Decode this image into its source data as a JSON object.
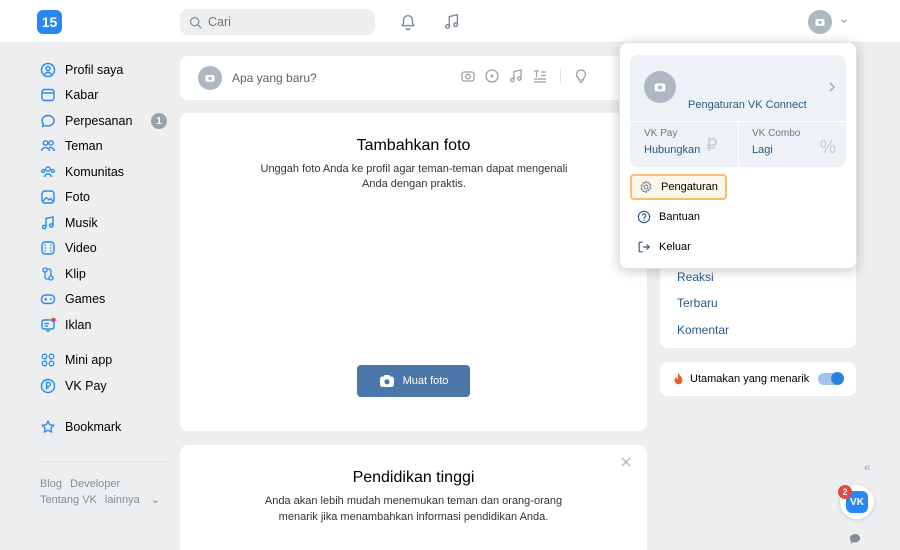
{
  "header": {
    "logo_text": "15",
    "search_placeholder": "Cari"
  },
  "sidebar": {
    "items": [
      {
        "label": "Profil saya",
        "icon": "user-circle-icon"
      },
      {
        "label": "Kabar",
        "icon": "newsfeed-icon"
      },
      {
        "label": "Perpesanan",
        "icon": "message-icon",
        "badge": "1"
      },
      {
        "label": "Teman",
        "icon": "friends-icon"
      },
      {
        "label": "Komunitas",
        "icon": "communities-icon"
      },
      {
        "label": "Foto",
        "icon": "photo-icon"
      },
      {
        "label": "Musik",
        "icon": "music-icon"
      },
      {
        "label": "Video",
        "icon": "video-icon"
      },
      {
        "label": "Klip",
        "icon": "clips-icon"
      },
      {
        "label": "Games",
        "icon": "games-icon"
      },
      {
        "label": "Iklan",
        "icon": "ads-icon"
      }
    ],
    "items2": [
      {
        "label": "Mini app",
        "icon": "mini-app-icon"
      },
      {
        "label": "VK Pay",
        "icon": "vk-pay-icon"
      }
    ],
    "bookmark": "Bookmark",
    "footer": {
      "blog": "Blog",
      "developer": "Developer",
      "about": "Tentang VK",
      "more": "lainnya"
    }
  },
  "composer": {
    "placeholder": "Apa yang baru?"
  },
  "photo_card": {
    "title": "Tambahkan foto",
    "description": "Unggah foto Anda ke profil agar teman-teman dapat mengenali Anda dengan praktis.",
    "button": "Muat foto"
  },
  "edu_card": {
    "title": "Pendidikan tinggi",
    "description": "Anda akan lebih mudah menemukan teman dan orang-orang menarik jika menambahkan informasi pendidikan Anda."
  },
  "filters": {
    "items": [
      "Reaksi",
      "Terbaru",
      "Komentar"
    ]
  },
  "highlight_toggle": {
    "label": "Utamakan yang menarik"
  },
  "dropdown": {
    "vk_connect": "Pengaturan VK Connect",
    "vk_pay_label": "VK Pay",
    "vk_pay_action": "Hubungkan",
    "vk_combo_label": "VK Combo",
    "vk_combo_action": "Lagi",
    "settings": "Pengaturan",
    "help": "Bantuan",
    "logout": "Keluar"
  },
  "widget": {
    "badge": "2",
    "logo": "VK"
  },
  "colors": {
    "accent": "#2787f5",
    "link": "#2a5885",
    "button": "#4a76a8",
    "highlight_border": "#f6bf6e"
  }
}
